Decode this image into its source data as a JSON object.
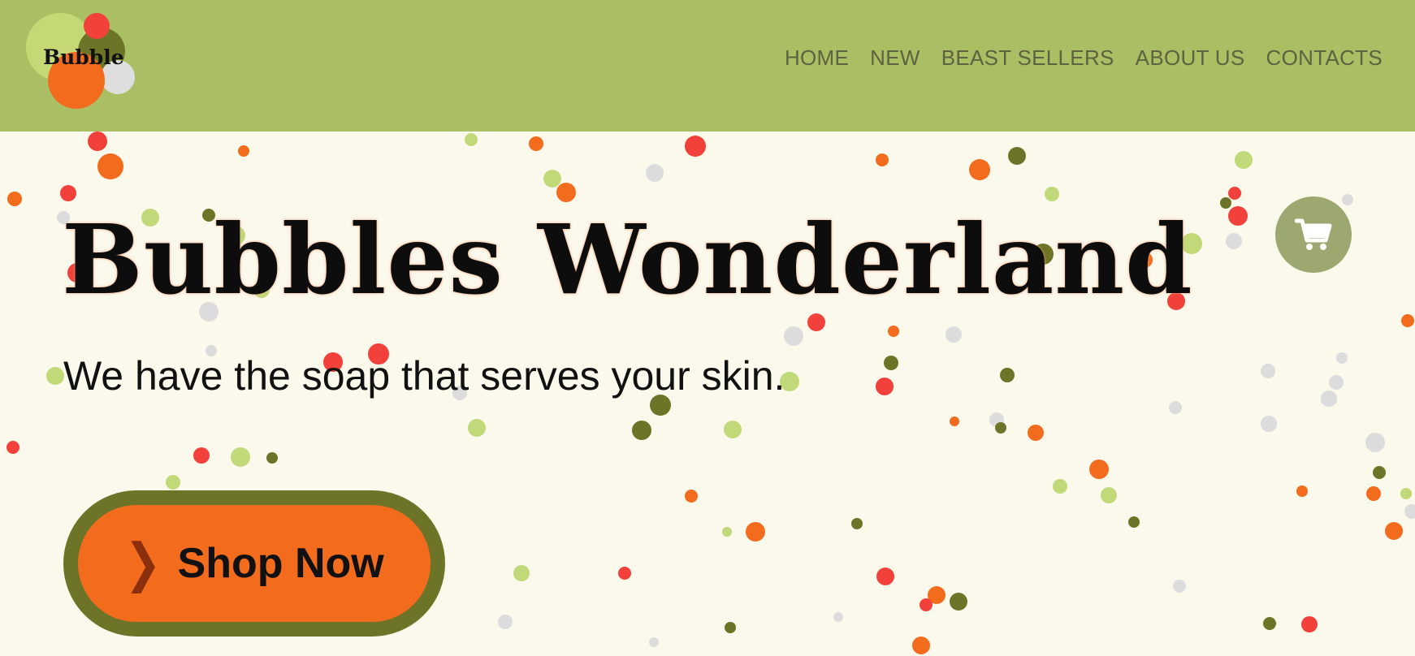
{
  "header": {
    "logo_text": "Bubble",
    "nav": [
      {
        "label": "HOME"
      },
      {
        "label": "NEW"
      },
      {
        "label": "BEAST SELLERS"
      },
      {
        "label": "ABOUT US"
      },
      {
        "label": "CONTACTS"
      }
    ]
  },
  "hero": {
    "title": "Bubbles Wonderland",
    "subtitle": "We have the soap that serves your skin.",
    "cta_label": "Shop Now"
  },
  "icons": {
    "cart": "shopping-cart-icon",
    "cta_chevron": "chevron-right-icon"
  },
  "colors": {
    "header_bg": "#aabf64",
    "page_bg": "#fbf8ec",
    "accent_orange": "#f36c1d",
    "accent_olive": "#6d7427",
    "bubble_red": "#f2403a",
    "bubble_lime": "#c1d979",
    "bubble_grey": "#dcdcdc",
    "cart_bg": "#9da870"
  }
}
